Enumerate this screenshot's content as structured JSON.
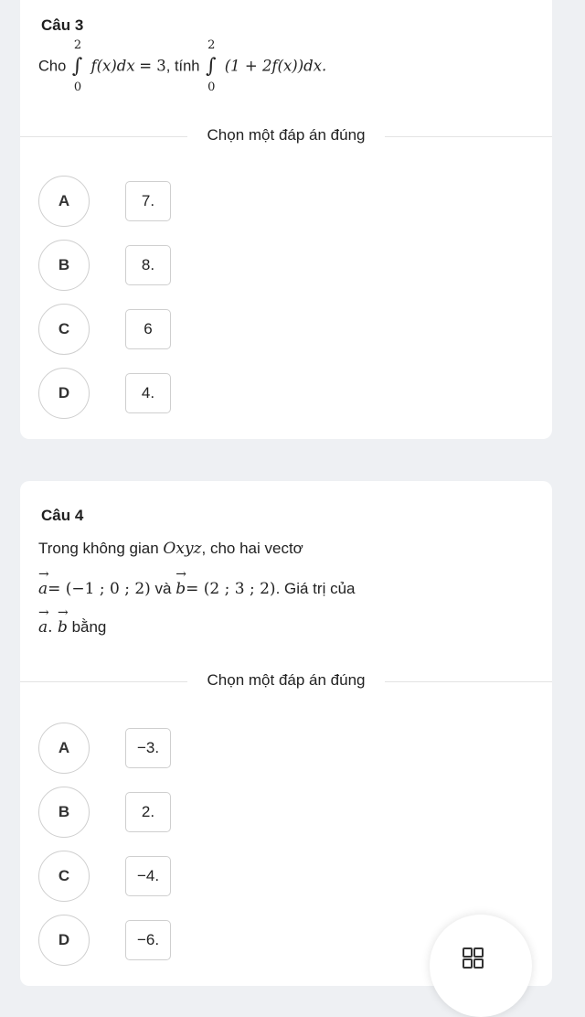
{
  "q3": {
    "title": "Câu 3",
    "stem_cho": "Cho",
    "int1_upper": "2",
    "int1_lower": "0",
    "int1_body": "f(x)dx",
    "int1_eq": "= 3",
    "stem_mid": ", tính",
    "int2_upper": "2",
    "int2_lower": "0",
    "int2_body": "(1 + 2f(x))dx.",
    "prompt": "Chọn một đáp án đúng",
    "options": [
      {
        "letter": "A",
        "answer": "7."
      },
      {
        "letter": "B",
        "answer": "8."
      },
      {
        "letter": "C",
        "answer": "6"
      },
      {
        "letter": "D",
        "answer": "4."
      }
    ]
  },
  "q4": {
    "title": "Câu 4",
    "line1_text": "Trong không gian ",
    "line1_math": "Oxyz",
    "line1_tail": ", cho hai vectơ",
    "vec_a": "a",
    "vec_a_val": "= (−1 ; 0 ; 2)",
    "va": " và ",
    "vec_b": "b",
    "vec_b_val": "= (2 ; 3 ; 2)",
    "line2_tail": ". Giá trị của",
    "dot_a": "a",
    "dot_sep": ". ",
    "dot_b": "b",
    "line3_tail": " bằng",
    "prompt": "Chọn một đáp án đúng",
    "options": [
      {
        "letter": "A",
        "answer": "−3."
      },
      {
        "letter": "B",
        "answer": "2."
      },
      {
        "letter": "C",
        "answer": "−4."
      },
      {
        "letter": "D",
        "answer": "−6."
      }
    ]
  },
  "fab": {
    "icon": "grid-icon"
  }
}
